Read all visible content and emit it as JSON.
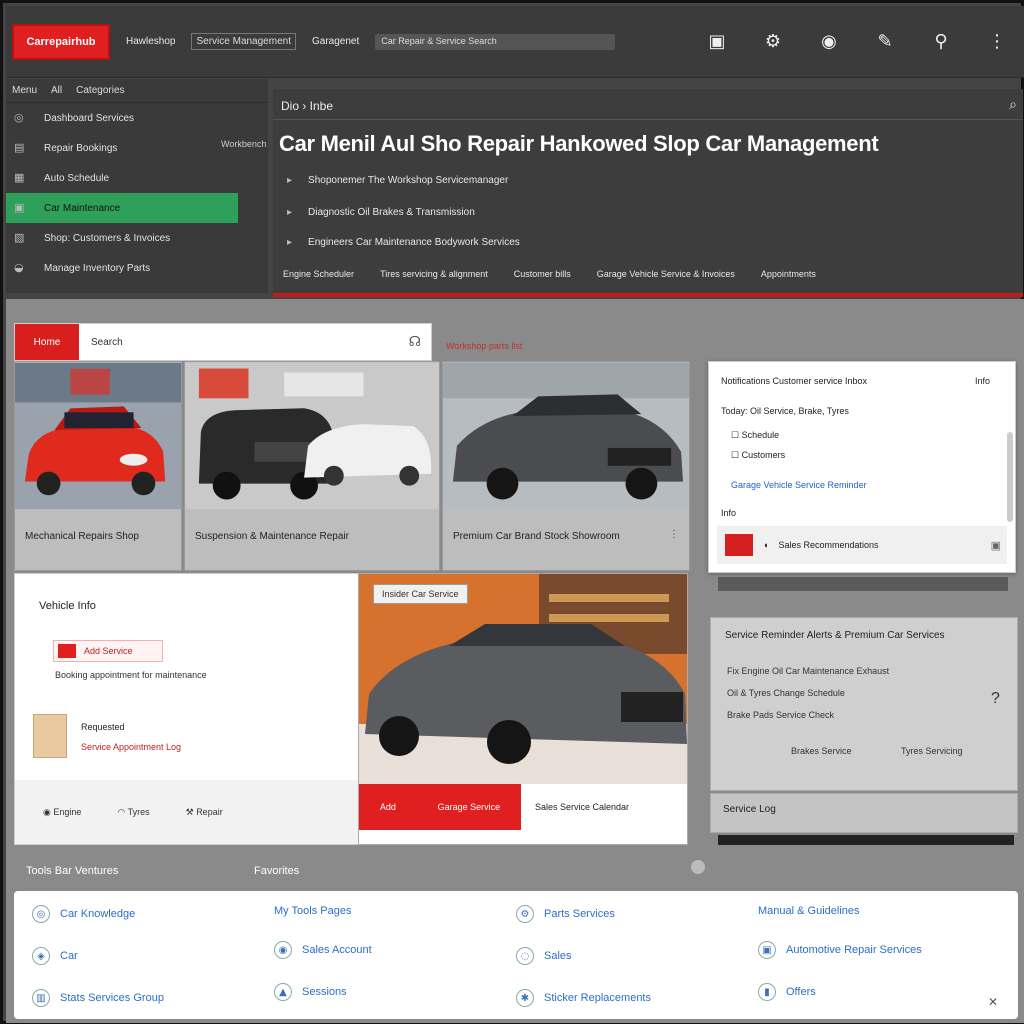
{
  "topbar": {
    "logo": "Carrepairhub",
    "links": [
      "Hawleshop",
      "Service Management",
      "Garagenet"
    ],
    "search": "Car Repair & Service Search",
    "icons": [
      "tablet-icon",
      "gear-icon",
      "circle-icon",
      "wrench-icon",
      "location-icon",
      "more-icon"
    ]
  },
  "sidebar": {
    "header": [
      "Menu",
      "All",
      "Categories"
    ],
    "items": [
      {
        "icon": "◎",
        "label": "Dashboard Services"
      },
      {
        "icon": "▤",
        "label": "Repair Bookings"
      },
      {
        "icon": "▦",
        "label": "Auto Schedule"
      },
      {
        "icon": "▣",
        "label": "Car Maintenance",
        "active": true
      },
      {
        "icon": "▧",
        "label": "Shop: Customers & Invoices"
      },
      {
        "icon": "◒",
        "label": "Manage Inventory Parts"
      }
    ]
  },
  "header": {
    "crumb": "Dio › Inbe",
    "side_label": "Workbench",
    "title": "Car Menil Aul Sho Repair Hankowed Slop Car Management",
    "lines": [
      "Shoponemer The Workshop Servicemanager",
      "Diagnostic Oil Brakes & Transmission",
      "Engineers Car Maintenance Bodywork Services"
    ],
    "footer": [
      "Engine Scheduler",
      "Tires servicing & alignment",
      "Customer bills",
      "Garage Vehicle Service & Invoices",
      "Appointments"
    ]
  },
  "search_card": {
    "tag": "Home",
    "text": "Search",
    "red_label": "Workshop parts list"
  },
  "cards": [
    {
      "caption": "Mechanical Repairs Shop"
    },
    {
      "caption": "Suspension & Maintenance Repair"
    },
    {
      "caption": "Premium Car Brand Stock Showroom"
    }
  ],
  "right_panel": {
    "header": "Notifications  Customer service Inbox",
    "sub": "Today: Oil Service, Brake, Tyres",
    "items": [
      "Schedule",
      "Customers"
    ],
    "blue_row": "Garage Vehicle Service Reminder",
    "small": "Info",
    "bar_text": "Sales Recommendations"
  },
  "left_card": {
    "title": "Vehicle Info",
    "red_button": "Add Service",
    "line": "Booking appointment for maintenance",
    "sub1": "Requested",
    "sub2": "Service Appointment Log",
    "footer": [
      "Engine",
      "Tyres",
      "Repair"
    ]
  },
  "feature": {
    "badge": "Insider Car Service",
    "red_left": "Add",
    "red_right": "Garage Service",
    "white": "Sales Service Calendar"
  },
  "right_mid": {
    "title": "Service Reminder Alerts & Premium Car Services",
    "rows": [
      "Fix Engine Oil Car Maintenance Exhaust",
      "Oil & Tyres Change Schedule",
      "Brake Pads Service Check"
    ],
    "left_label": "Brakes Service",
    "right_label": "Tyres Servicing",
    "foot": "Service Log"
  },
  "sections": {
    "left": "Tools Bar Ventures",
    "right": "Favorites"
  },
  "bottom": [
    [
      "Car Knowledge",
      "Car",
      "Stats Services Group"
    ],
    [
      "My Tools Pages",
      "Sales Account",
      "Sessions"
    ],
    [
      "Parts Services",
      "Sales",
      "Sticker Replacements"
    ],
    [
      "Manual & Guidelines",
      "Automotive Repair Services",
      "Offers"
    ]
  ]
}
